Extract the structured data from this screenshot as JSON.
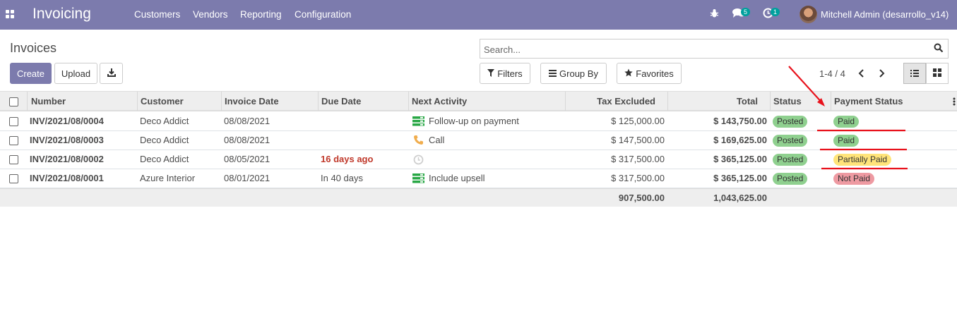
{
  "app": {
    "brand": "Invoicing",
    "menu": [
      "Customers",
      "Vendors",
      "Reporting",
      "Configuration"
    ],
    "messages_count": "5",
    "activities_count": "1",
    "user": "Mitchell Admin (desarrollo_v14)"
  },
  "control_panel": {
    "title": "Invoices",
    "search_placeholder": "Search...",
    "create_label": "Create",
    "upload_label": "Upload",
    "filters_label": "Filters",
    "groupby_label": "Group By",
    "favorites_label": "Favorites",
    "pager": "1-4 / 4"
  },
  "columns": {
    "number": "Number",
    "customer": "Customer",
    "invoice_date": "Invoice Date",
    "due_date": "Due Date",
    "next_activity": "Next Activity",
    "tax_excluded": "Tax Excluded",
    "total": "Total",
    "status": "Status",
    "payment_status": "Payment Status"
  },
  "rows": [
    {
      "number": "INV/2021/08/0004",
      "customer": "Deco Addict",
      "invoice_date": "08/08/2021",
      "due_date": "",
      "activity_icon": "bars-icon",
      "activity": "Follow-up on payment",
      "tax_excluded": "$ 125,000.00",
      "total": "$ 143,750.00",
      "status": "Posted",
      "payment_status": "Paid"
    },
    {
      "number": "INV/2021/08/0003",
      "customer": "Deco Addict",
      "invoice_date": "08/08/2021",
      "due_date": "",
      "activity_icon": "phone-icon",
      "activity": "Call",
      "tax_excluded": "$ 147,500.00",
      "total": "$ 169,625.00",
      "status": "Posted",
      "payment_status": "Paid"
    },
    {
      "number": "INV/2021/08/0002",
      "customer": "Deco Addict",
      "invoice_date": "08/05/2021",
      "due_date": "16 days ago",
      "activity_icon": "clock-icon",
      "activity": "",
      "tax_excluded": "$ 317,500.00",
      "total": "$ 365,125.00",
      "status": "Posted",
      "payment_status": "Partially Paid"
    },
    {
      "number": "INV/2021/08/0001",
      "customer": "Azure Interior",
      "invoice_date": "08/01/2021",
      "due_date": "In 40 days",
      "activity_icon": "bars-icon",
      "activity": "Include upsell",
      "tax_excluded": "$ 317,500.00",
      "total": "$ 365,125.00",
      "status": "Posted",
      "payment_status": "Not Paid"
    }
  ],
  "totals": {
    "tax_excluded": "907,500.00",
    "total": "1,043,625.00"
  },
  "colors": {
    "navbar": "#7c7bad",
    "posted_badge": "#8fd08f",
    "paid_badge": "#8fd08f",
    "partial_badge": "#ffe47a",
    "notpaid_badge": "#ee9aa2",
    "annotation": "#e8121c"
  }
}
